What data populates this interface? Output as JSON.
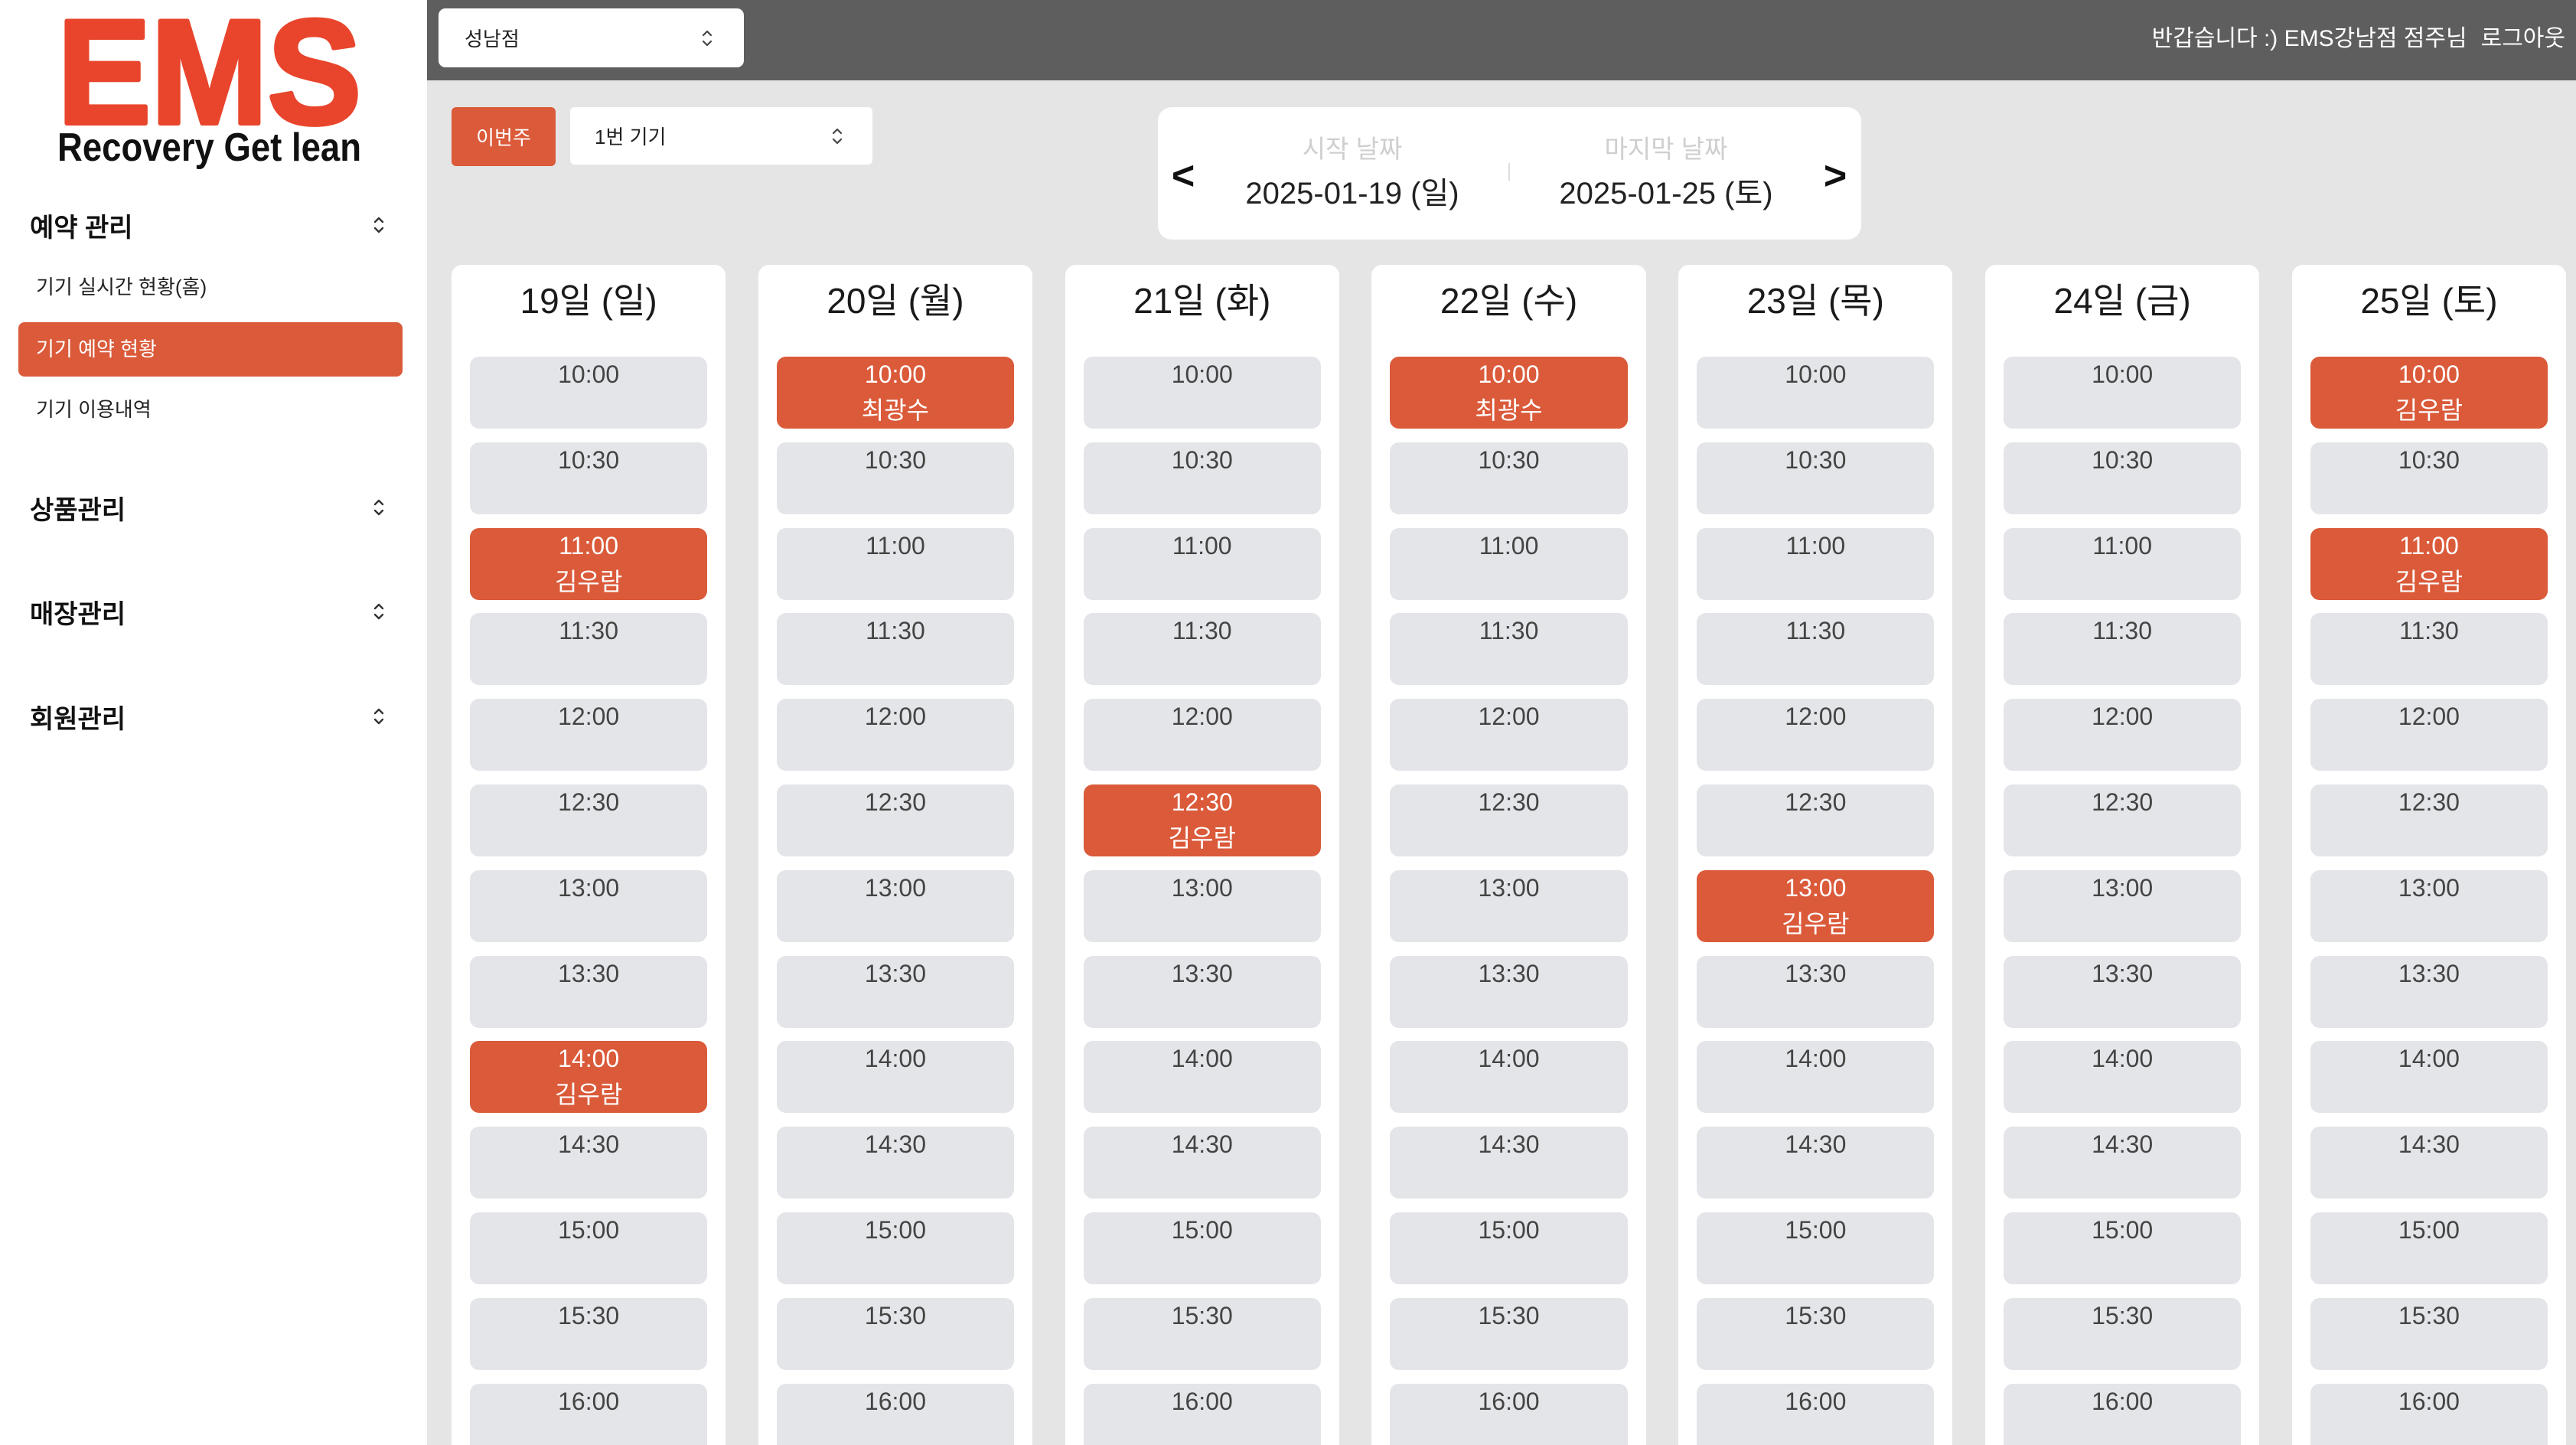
{
  "logo": {
    "mark": "EMS",
    "tagline": "Recovery Get lean"
  },
  "sidebar": {
    "sections": [
      {
        "label": "예약 관리",
        "expanded": true,
        "items": [
          {
            "label": "기기 실시간 현황(홈)",
            "active": false
          },
          {
            "label": "기기 예약 현황",
            "active": true
          },
          {
            "label": "기기 이용내역",
            "active": false
          }
        ]
      },
      {
        "label": "상품관리",
        "expanded": false,
        "items": []
      },
      {
        "label": "매장관리",
        "expanded": false,
        "items": []
      },
      {
        "label": "회원관리",
        "expanded": false,
        "items": []
      }
    ]
  },
  "header": {
    "store_select": "성남점",
    "greeting": "반갑습니다 :) EMS강남점 점주님",
    "logout": "로그아웃"
  },
  "toolbar": {
    "this_week": "이번주",
    "device_select": "1번 기기"
  },
  "date_range": {
    "prev": "<",
    "next": ">",
    "start_label": "시작 날짜",
    "start_value": "2025-01-19 (일)",
    "end_label": "마지막 날짜",
    "end_value": "2025-01-25 (토)"
  },
  "schedule": {
    "time_slots": [
      "10:00",
      "10:30",
      "11:00",
      "11:30",
      "12:00",
      "12:30",
      "13:00",
      "13:30",
      "14:00",
      "14:30",
      "15:00",
      "15:30",
      "16:00"
    ],
    "days": [
      {
        "label": "19일 (일)",
        "bookings": [
          {
            "time": "11:00",
            "name": "김우람"
          },
          {
            "time": "14:00",
            "name": "김우람"
          }
        ]
      },
      {
        "label": "20일 (월)",
        "bookings": [
          {
            "time": "10:00",
            "name": "최광수"
          }
        ]
      },
      {
        "label": "21일 (화)",
        "bookings": [
          {
            "time": "12:30",
            "name": "김우람"
          }
        ]
      },
      {
        "label": "22일 (수)",
        "bookings": [
          {
            "time": "10:00",
            "name": "최광수"
          }
        ]
      },
      {
        "label": "23일 (목)",
        "bookings": [
          {
            "time": "13:00",
            "name": "김우람"
          }
        ]
      },
      {
        "label": "24일 (금)",
        "bookings": []
      },
      {
        "label": "25일 (토)",
        "bookings": [
          {
            "time": "10:00",
            "name": "김우람"
          },
          {
            "time": "11:00",
            "name": "김우람"
          }
        ]
      }
    ]
  },
  "icons": {
    "section_toggle": "chevron-updown-icon",
    "select_arrow": "chevron-updown-icon"
  },
  "colors": {
    "accent": "#DA5A3A",
    "logo": "#E8452C",
    "topbar": "#5E5E5E",
    "background": "#E5E5E5",
    "slot": "#E4E5E9"
  }
}
